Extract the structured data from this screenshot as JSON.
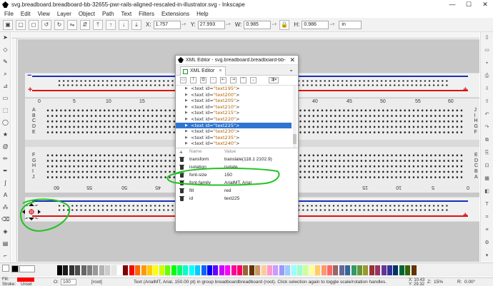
{
  "window": {
    "title": "svg.breadboard.breadboard-bb-32655-pwr-rails-aligned-rescaled-in-illustrator.svg - Inkscape",
    "minimize": "—",
    "maximize": "☐",
    "close": "✕"
  },
  "menu": [
    "File",
    "Edit",
    "View",
    "Layer",
    "Object",
    "Path",
    "Text",
    "Filters",
    "Extensions",
    "Help"
  ],
  "toolbar": {
    "x_label": "X:",
    "x_value": "1.757",
    "y_label": "Y:",
    "y_value": "27.993",
    "w_label": "W:",
    "w_value": "0.985",
    "h_label": "H:",
    "h_value": "0.986",
    "unit": "in"
  },
  "breadboard": {
    "top_numbers": [
      "0",
      "5",
      "10",
      "15",
      "40",
      "45",
      "50",
      "55",
      "60"
    ],
    "bottom_numbers": [
      "60",
      "55",
      "50",
      "45",
      "20",
      "15",
      "10",
      "5",
      "0"
    ],
    "rows_top": [
      "A",
      "B",
      "C",
      "D",
      "E"
    ],
    "rows_bottom": [
      "F",
      "G",
      "H",
      "I",
      "J"
    ],
    "rows_top_right": [
      "J",
      "I",
      "H",
      "G",
      "F"
    ],
    "rows_bottom_right": [
      "E",
      "D",
      "C",
      "B",
      "A"
    ],
    "minus": "−",
    "plus": "+"
  },
  "xml_editor": {
    "title": "XML Editor - svg.breadboard.breadboard-bb-32655-p...",
    "tab_label": "XML Editor",
    "nodes": [
      {
        "prefix": "<text id=",
        "id": "\"text195\"",
        "suffix": ">"
      },
      {
        "prefix": "<text id=",
        "id": "\"text200\"",
        "suffix": ">"
      },
      {
        "prefix": "<text id=",
        "id": "\"text205\"",
        "suffix": ">"
      },
      {
        "prefix": "<text id=",
        "id": "\"text210\"",
        "suffix": ">"
      },
      {
        "prefix": "<text id=",
        "id": "\"text215\"",
        "suffix": ">"
      },
      {
        "prefix": "<text id=",
        "id": "\"text220\"",
        "suffix": ">"
      },
      {
        "prefix": "<text id=",
        "id": "\"text225\"",
        "suffix": ">"
      },
      {
        "prefix": "<text id=",
        "id": "\"text230\"",
        "suffix": ">"
      },
      {
        "prefix": "<text id=",
        "id": "\"text235\"",
        "suffix": ">"
      },
      {
        "prefix": "<text id=",
        "id": "\"text240\"",
        "suffix": ">"
      }
    ],
    "selected_index": 6,
    "attr_header_name": "Name",
    "attr_header_value": "Value",
    "attributes": [
      {
        "name": "transform",
        "value": "translate(118.1 2102.9)"
      },
      {
        "name": "isolation",
        "value": "isolate"
      },
      {
        "name": "font-size",
        "value": "150"
      },
      {
        "name": "font-family",
        "value": "ArialMT, Arial"
      },
      {
        "name": "fill",
        "value": "red"
      },
      {
        "name": "id",
        "value": "text225"
      }
    ]
  },
  "statusbar": {
    "fill_label": "Fill:",
    "stroke_label": "Stroke:",
    "unset_label": "Unset",
    "opacity_label": "O:",
    "opacity_value": "100",
    "layer": "[root]",
    "message": "Text (ArialMT, Arial, 150.00 pt) in group breadboardbreadboard (root). Click selection again to toggle scale/rotation handles.",
    "x_coord": "X: 10.43",
    "y_coord": "Y: 29.32",
    "zoom_label": "Z:",
    "zoom": "15%",
    "rotation_label": "R:",
    "rotation": "0.00°"
  },
  "colors": {
    "accent": "#2f74d0",
    "annotation": "#22c322",
    "rail_blue": "#1a2fb8",
    "rail_red": "#dd1111",
    "fill_red": "#ff0000"
  },
  "palette": [
    "#000000",
    "#1a1a1a",
    "#333333",
    "#4d4d4d",
    "#666666",
    "#808080",
    "#999999",
    "#b3b3b3",
    "#cccccc",
    "#e6e6e6",
    "#ffffff",
    "#800000",
    "#ff0000",
    "#ff6600",
    "#ff9900",
    "#ffcc00",
    "#ffff00",
    "#ccff00",
    "#66ff00",
    "#00ff00",
    "#00ff66",
    "#00ffcc",
    "#00ffff",
    "#00ccff",
    "#0066ff",
    "#0000ff",
    "#6600ff",
    "#cc00ff",
    "#ff00ff",
    "#ff0099",
    "#ff0066",
    "#996633",
    "#663300",
    "#cc9966",
    "#ffcc99",
    "#ff99cc",
    "#cc99ff",
    "#9999ff",
    "#99ccff",
    "#99ffff",
    "#99ffcc",
    "#ccff99",
    "#ffff99",
    "#ffcc66",
    "#ff9966",
    "#ff6666",
    "#996666",
    "#666699",
    "#336699",
    "#339966",
    "#669933",
    "#999933",
    "#993333",
    "#993366",
    "#663399",
    "#333399",
    "#003366",
    "#006633",
    "#336600",
    "#663300"
  ]
}
